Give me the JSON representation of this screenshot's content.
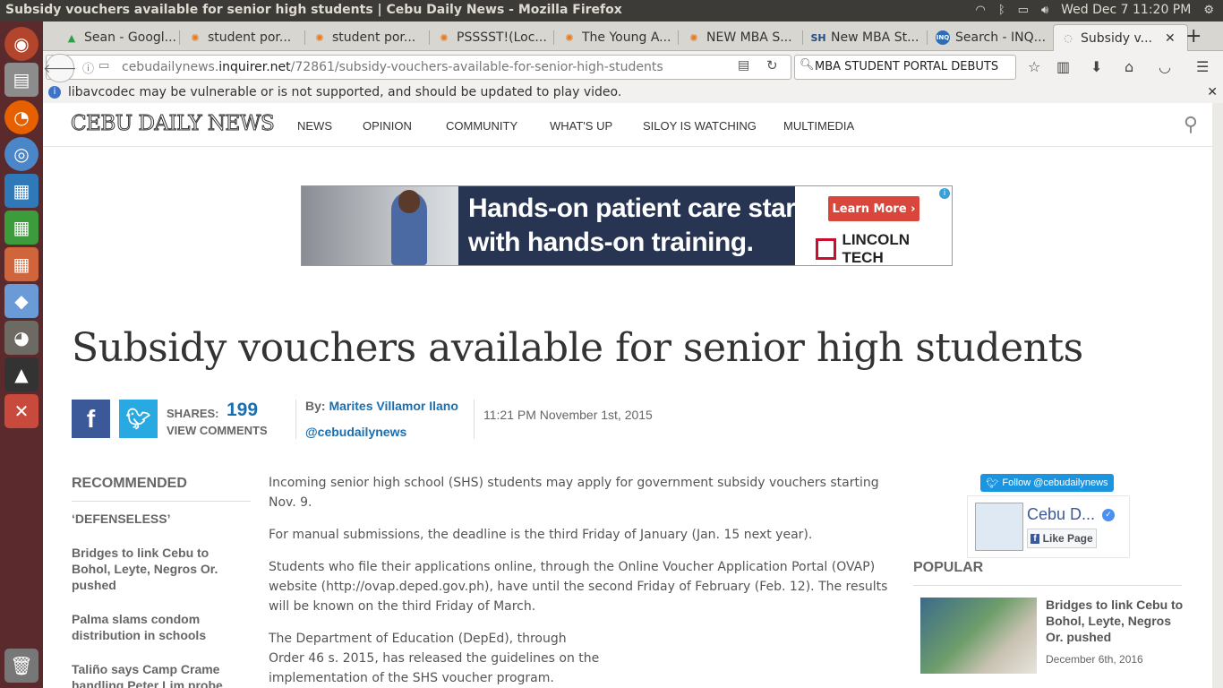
{
  "os": {
    "window_title": "Subsidy vouchers available for senior high students | Cebu Daily News - Mozilla Firefox",
    "clock": "Wed Dec  7 11:20 PM"
  },
  "browser": {
    "tabs": [
      {
        "label": "Sean - Googl...",
        "icon": "google-drive-icon"
      },
      {
        "label": "student por...",
        "icon": "fox-icon"
      },
      {
        "label": "student por...",
        "icon": "fox-icon"
      },
      {
        "label": "PSSSST!(Loc...",
        "icon": "fox-icon"
      },
      {
        "label": "The Young A...",
        "icon": "fox-icon"
      },
      {
        "label": "NEW MBA S...",
        "icon": "fox-icon"
      },
      {
        "label": "New MBA St...",
        "icon": "sh-icon"
      },
      {
        "label": "Search - INQ...",
        "icon": "inq-icon"
      },
      {
        "label": "Subsidy v...",
        "icon": "loading-icon",
        "active": true
      }
    ],
    "url_prefix": "cebudailynews.",
    "url_domain": "inquirer.net",
    "url_path": "/72861/subsidy-vouchers-available-for-senior-high-students",
    "search_query": "MBA STUDENT PORTAL DEBUTS",
    "notification": "libavcodec may be vulnerable or is not supported, and should be updated to play video."
  },
  "site": {
    "logo": "CEBU DAILY NEWS",
    "nav": [
      "NEWS",
      "OPINION",
      "COMMUNITY",
      "WHAT'S UP",
      "SILOY IS WATCHING",
      "MULTIMEDIA"
    ]
  },
  "ad": {
    "headline_1": "Hands-on patient care starts",
    "headline_2": "with hands-on training.",
    "cta": "Learn More ›",
    "brand": "LINCOLN TECH"
  },
  "article": {
    "title": "Subsidy vouchers available for senior high students",
    "shares_label": "SHARES:",
    "shares_count": "199",
    "view_comments": "VIEW COMMENTS",
    "by_label": "By:",
    "author": "Marites Villamor Ilano",
    "handle": "@cebudailynews",
    "date": "11:21 PM November 1st, 2015",
    "paragraphs": [
      "Incoming senior high school (SHS) students may apply for government subsidy vouchers starting Nov. 9.",
      "For manual submissions, the deadline is the third Friday of January (Jan. 15 next year).",
      "Students who file their applications online, through the Online Voucher Application Portal (OVAP) website (http://ovap.deped.gov.ph), have until the second Friday of February (Feb. 12). The results will be known on the third Friday of March.",
      "The Department of Education (DepEd), through Order 46 s. 2015, has released the guidelines on the implementation of the SHS voucher program."
    ]
  },
  "recommended": {
    "title": "RECOMMENDED",
    "items": [
      "‘DEFENSELESS’",
      "Bridges to link Cebu to Bohol, Leyte, Negros Or. pushed",
      "Palma slams condom distribution in schools",
      "Taliño says Camp Crame handling Peter Lim probe"
    ]
  },
  "sidebar": {
    "twitter_follow": "Follow @cebudailynews",
    "fb_name": "Cebu D...",
    "fb_like": "Like Page",
    "popular_title": "POPULAR",
    "popular_item_title": "Bridges to link Cebu to Bohol, Leyte, Negros Or. pushed",
    "popular_item_date": "December 6th, 2016"
  }
}
